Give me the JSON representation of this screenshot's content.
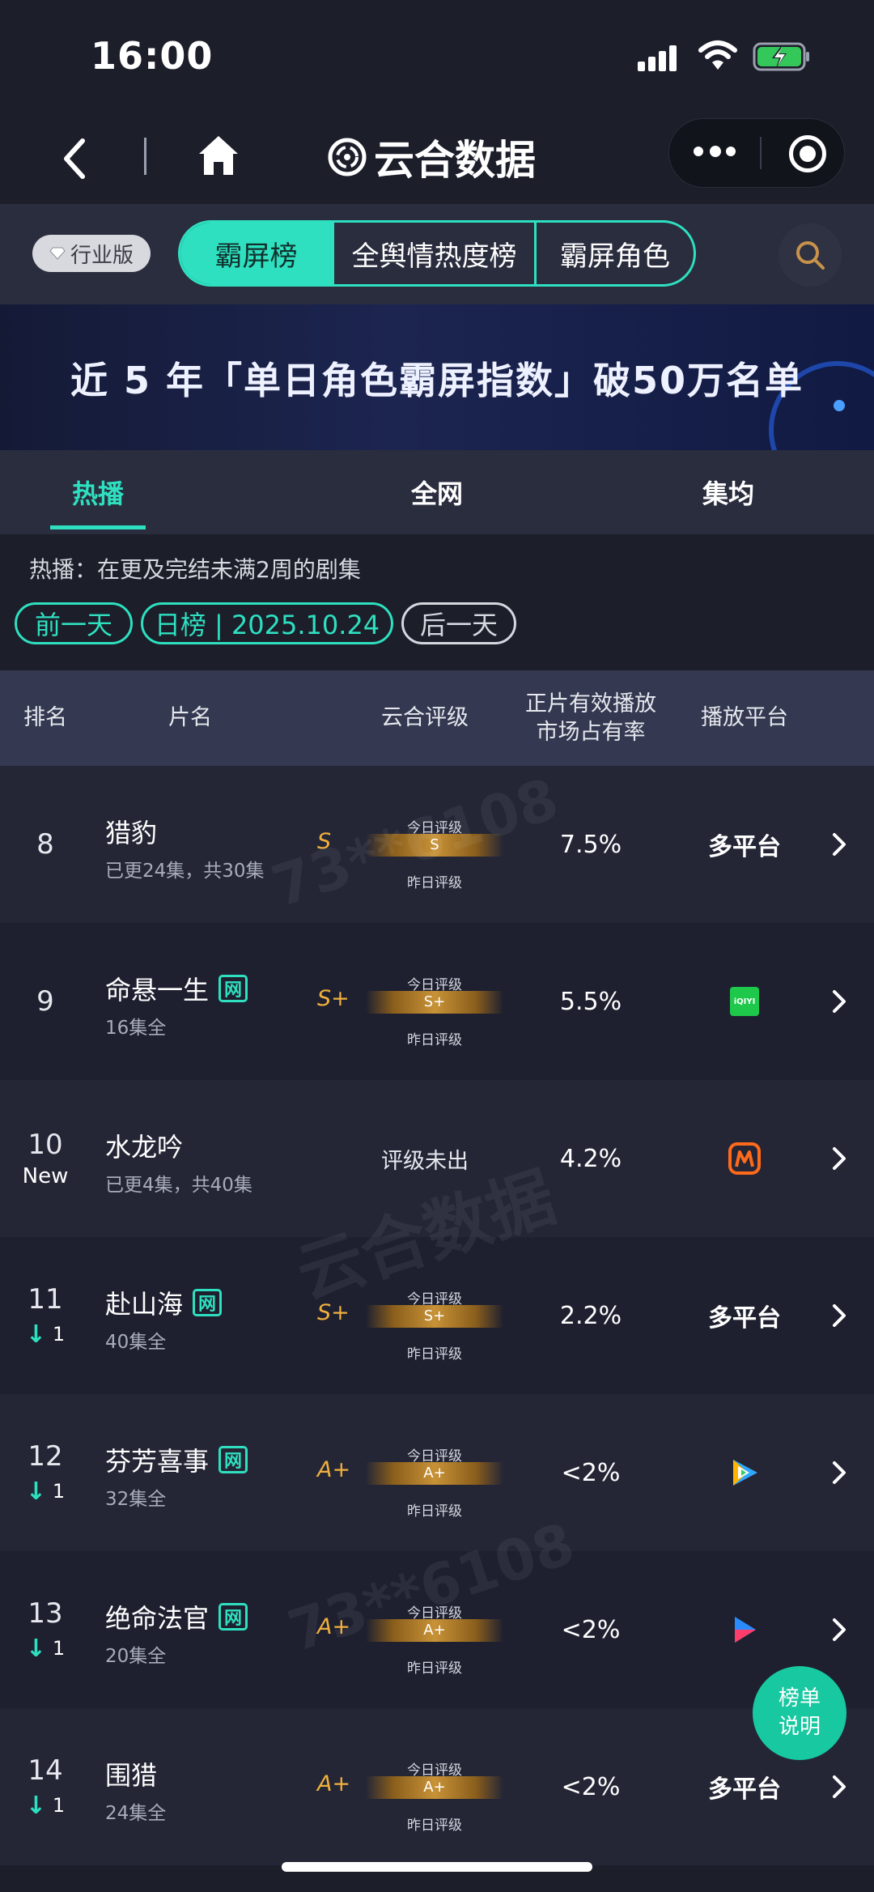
{
  "status_bar": {
    "time": "16:00"
  },
  "nav": {
    "app_title": "云合数据"
  },
  "edition_badge": "行业版",
  "main_tabs": [
    {
      "label": "霸屏榜",
      "active": true
    },
    {
      "label": "全舆情热度榜",
      "active": false
    },
    {
      "label": "霸屏角色",
      "active": false
    }
  ],
  "banner": {
    "text": "近 5 年「单日角色霸屏指数」破50万名单"
  },
  "sub_tabs": [
    {
      "label": "热播",
      "active": true
    },
    {
      "label": "全网",
      "active": false
    },
    {
      "label": "集均",
      "active": false
    }
  ],
  "description": "热播：在更及完结未满2周的剧集",
  "date_nav": {
    "prev": "前一天",
    "current": "日榜 | 2025.10.24",
    "next": "后一天"
  },
  "table": {
    "headers": [
      "排名",
      "片名",
      "云合评级",
      "正片有效播放\n市场占有率",
      "播放平台"
    ],
    "rating_today_label": "今日评级",
    "rating_yesterday_label": "昨日评级",
    "net_badge": "网",
    "rows": [
      {
        "rank": "8",
        "change": "",
        "title": "猎豹",
        "net": false,
        "episodes": "已更24集，共30集",
        "grade": "S",
        "rating_bar": "S",
        "share": "7.5%",
        "platform": "多平台",
        "platform_icon": ""
      },
      {
        "rank": "9",
        "change": "",
        "title": "命悬一生",
        "net": true,
        "episodes": "16集全",
        "grade": "S+",
        "rating_bar": "S+",
        "share": "5.5%",
        "platform": "",
        "platform_icon": "iqiyi-icon"
      },
      {
        "rank": "10",
        "change": "New",
        "title": "水龙吟",
        "net": false,
        "episodes": "已更4集，共40集",
        "grade": "",
        "rating_bar": "",
        "rating_none": "评级未出",
        "share": "4.2%",
        "platform": "",
        "platform_icon": "mango-tv-icon"
      },
      {
        "rank": "11",
        "change": "1",
        "title": "赴山海",
        "net": true,
        "episodes": "40集全",
        "grade": "S+",
        "rating_bar": "S+",
        "share": "2.2%",
        "platform": "多平台",
        "platform_icon": ""
      },
      {
        "rank": "12",
        "change": "1",
        "title": "芬芳喜事",
        "net": true,
        "episodes": "32集全",
        "grade": "A+",
        "rating_bar": "A+",
        "share": "<2%",
        "platform": "",
        "platform_icon": "tencent-video-icon"
      },
      {
        "rank": "13",
        "change": "1",
        "title": "绝命法官",
        "net": true,
        "episodes": "20集全",
        "grade": "A+",
        "rating_bar": "A+",
        "share": "<2%",
        "platform": "",
        "platform_icon": "youku-icon"
      },
      {
        "rank": "14",
        "change": "1",
        "title": "围猎",
        "net": false,
        "episodes": "24集全",
        "grade": "A+",
        "rating_bar": "A+",
        "share": "<2%",
        "platform": "多平台",
        "platform_icon": ""
      }
    ]
  },
  "fab": {
    "line1": "榜单",
    "line2": "说明"
  },
  "watermarks": {
    "number": "73**6108",
    "brand": "云合数据"
  },
  "colors": {
    "accent": "#2ee0c0",
    "background": "#1c1e2a",
    "grade_gold": "#f0b03c"
  }
}
